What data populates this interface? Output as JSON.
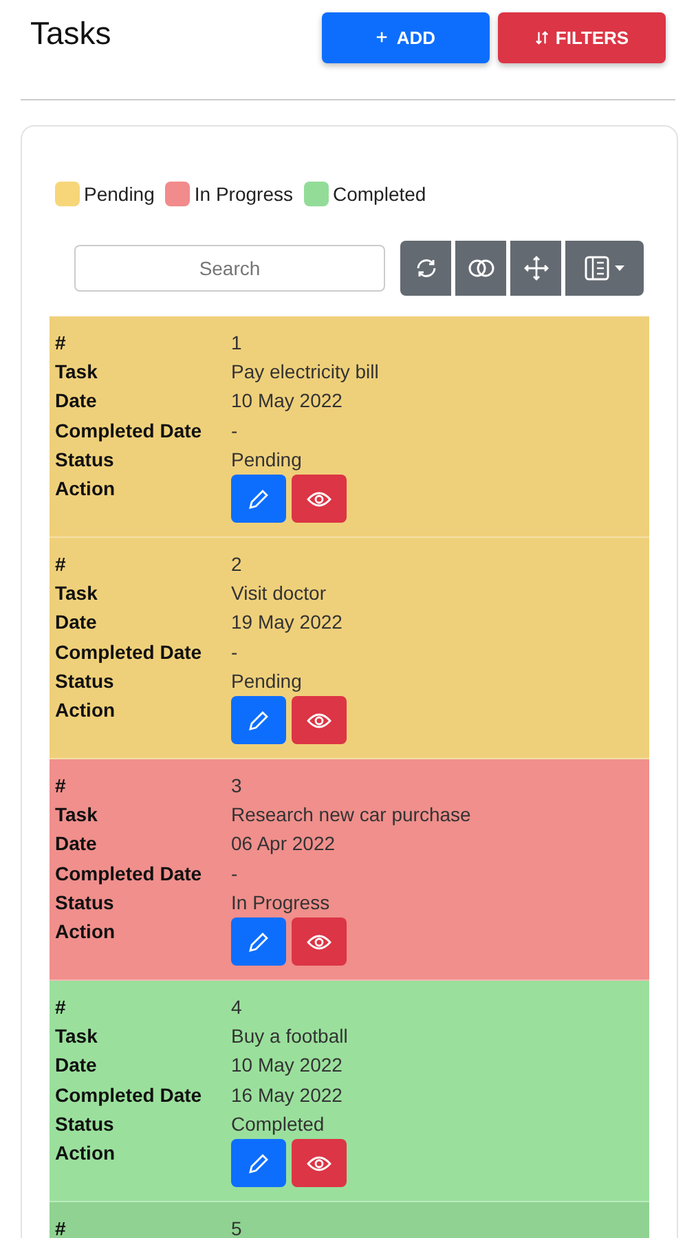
{
  "title": "Tasks",
  "buttons": [
    {
      "kind": "add",
      "label": "ADD"
    },
    {
      "kind": "filters",
      "label": "FILTERS"
    }
  ],
  "legend": [
    {
      "label": "Pending",
      "color": "#f7d67a"
    },
    {
      "label": "In Progress",
      "color": "#f28b8b"
    },
    {
      "label": "Completed",
      "color": "#93dc98"
    }
  ],
  "search": {
    "placeholder": "Search"
  },
  "rows": [
    {
      "color": "#efd07a",
      "fields": [
        {
          "kind": "text",
          "label": "#",
          "value": "1"
        },
        {
          "kind": "text",
          "label": "Task",
          "value": "Pay electricity bill"
        },
        {
          "kind": "text",
          "label": "Date",
          "value": "10 May 2022"
        },
        {
          "kind": "text",
          "label": "Completed Date",
          "value": "-"
        },
        {
          "kind": "text",
          "label": "Status",
          "value": "Pending"
        },
        {
          "kind": "actions",
          "label": "Action"
        }
      ]
    },
    {
      "color": "#efd07a",
      "fields": [
        {
          "kind": "text",
          "label": "#",
          "value": "2"
        },
        {
          "kind": "text",
          "label": "Task",
          "value": "Visit doctor"
        },
        {
          "kind": "text",
          "label": "Date",
          "value": "19 May 2022"
        },
        {
          "kind": "text",
          "label": "Completed Date",
          "value": "-"
        },
        {
          "kind": "text",
          "label": "Status",
          "value": "Pending"
        },
        {
          "kind": "actions",
          "label": "Action"
        }
      ]
    },
    {
      "color": "#f08f8c",
      "fields": [
        {
          "kind": "text",
          "label": "#",
          "value": "3"
        },
        {
          "kind": "text",
          "label": "Task",
          "value": "Research new car purchase"
        },
        {
          "kind": "text",
          "label": "Date",
          "value": "06 Apr 2022"
        },
        {
          "kind": "text",
          "label": "Completed Date",
          "value": "-"
        },
        {
          "kind": "text",
          "label": "Status",
          "value": "In Progress"
        },
        {
          "kind": "actions",
          "label": "Action"
        }
      ]
    },
    {
      "color": "#9ae09c",
      "fields": [
        {
          "kind": "text",
          "label": "#",
          "value": "4"
        },
        {
          "kind": "text",
          "label": "Task",
          "value": "Buy a football"
        },
        {
          "kind": "text",
          "label": "Date",
          "value": "10 May 2022"
        },
        {
          "kind": "text",
          "label": "Completed Date",
          "value": "16 May 2022"
        },
        {
          "kind": "text",
          "label": "Status",
          "value": "Completed"
        },
        {
          "kind": "actions",
          "label": "Action"
        }
      ]
    },
    {
      "color": "#8fd291",
      "fields": [
        {
          "kind": "text",
          "label": "#",
          "value": "5"
        }
      ]
    }
  ]
}
